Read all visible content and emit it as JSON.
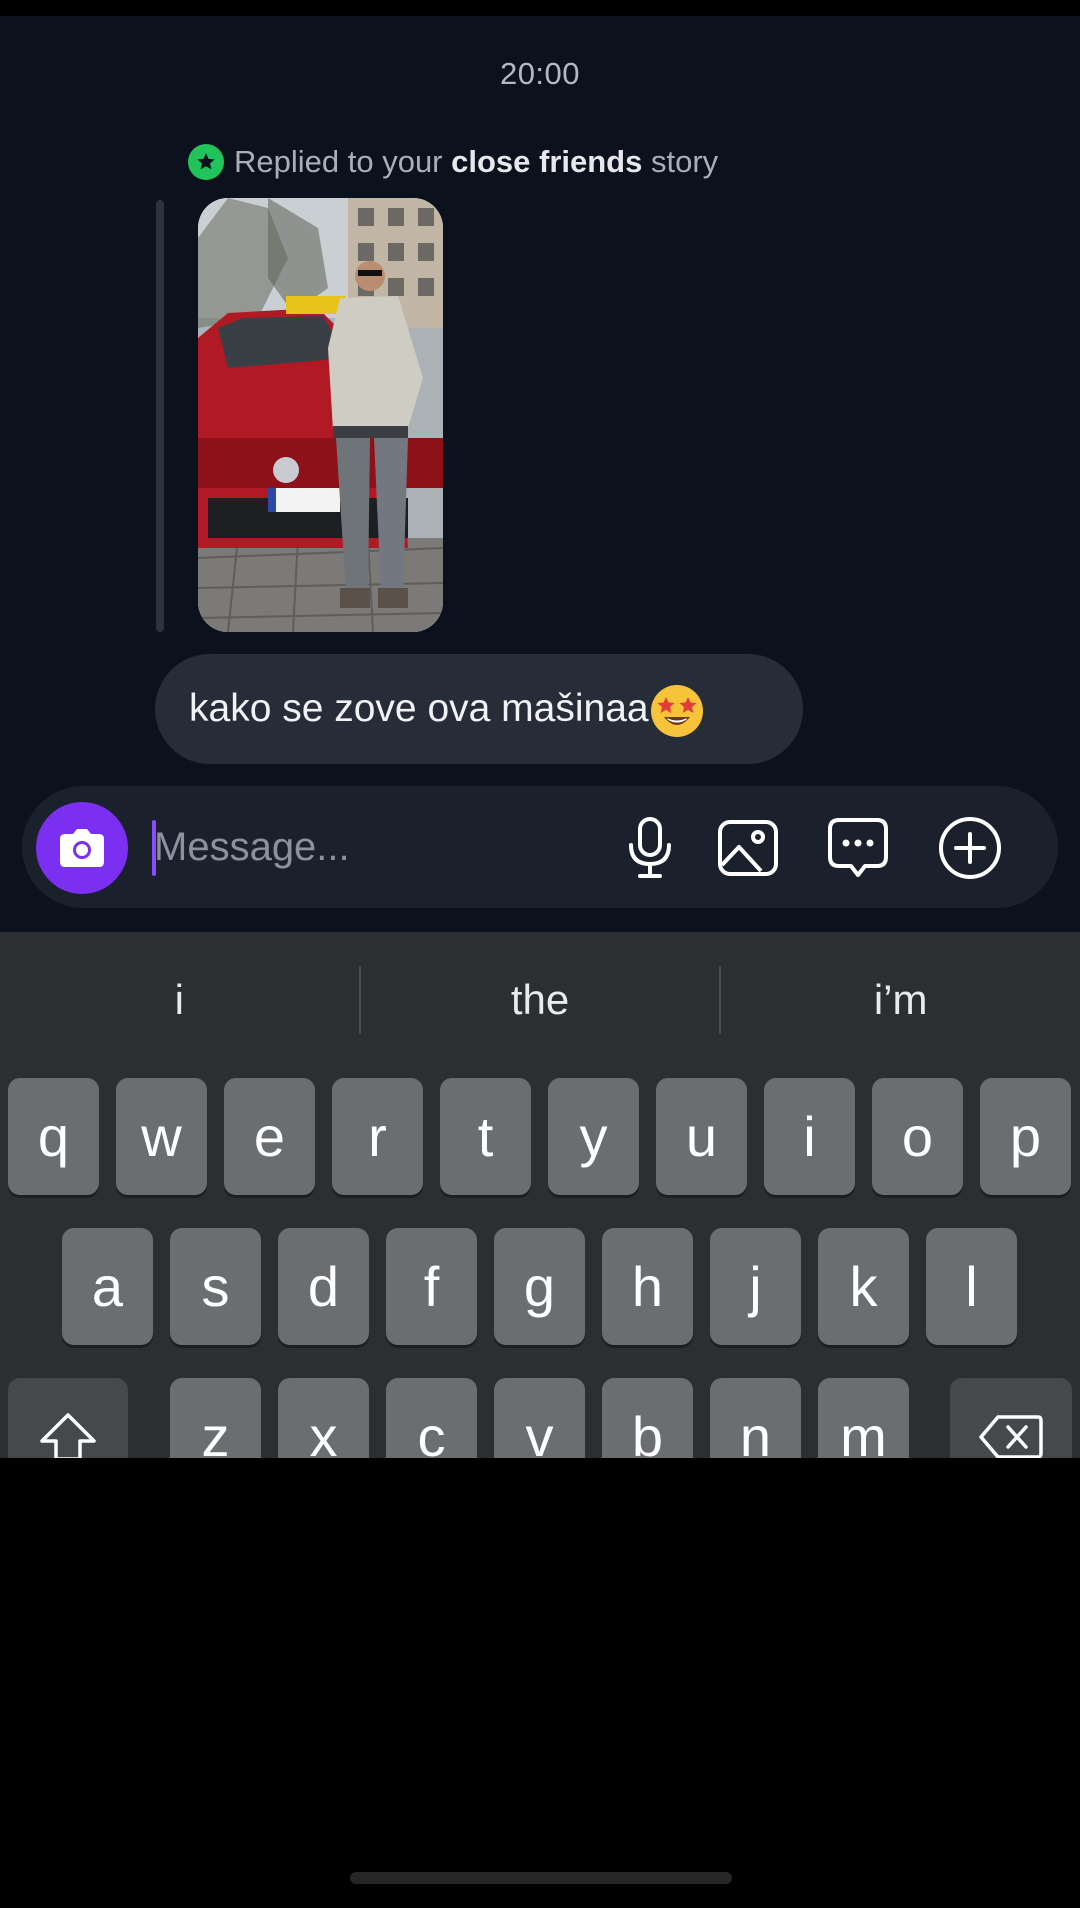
{
  "chat": {
    "timestamp": "20:00",
    "reply_note": {
      "prefix": "Replied to your ",
      "emphasis": "close friends",
      "suffix": " story"
    },
    "message": "kako se zove ova mašinaa",
    "message_emoji": "star-struck-emoji"
  },
  "composer": {
    "placeholder": "Message...",
    "icons": [
      "camera-icon",
      "microphone-icon",
      "gallery-icon",
      "sticker-icon",
      "add-icon"
    ],
    "camera_color": "#7b2ff0"
  },
  "keyboard": {
    "suggestions": [
      "i",
      "the",
      "i’m"
    ],
    "row1": [
      "q",
      "w",
      "e",
      "r",
      "t",
      "y",
      "u",
      "i",
      "o",
      "p"
    ],
    "row2": [
      "a",
      "s",
      "d",
      "f",
      "g",
      "h",
      "j",
      "k",
      "l"
    ],
    "row3": [
      "z",
      "x",
      "c",
      "v",
      "b",
      "n",
      "m"
    ]
  },
  "colors": {
    "chat_background": "#0b111d",
    "bubble": "#262c38",
    "close_friends_badge": "#21c45a",
    "keyboard_background": "#2b2f31",
    "key": "#6b6e71"
  }
}
